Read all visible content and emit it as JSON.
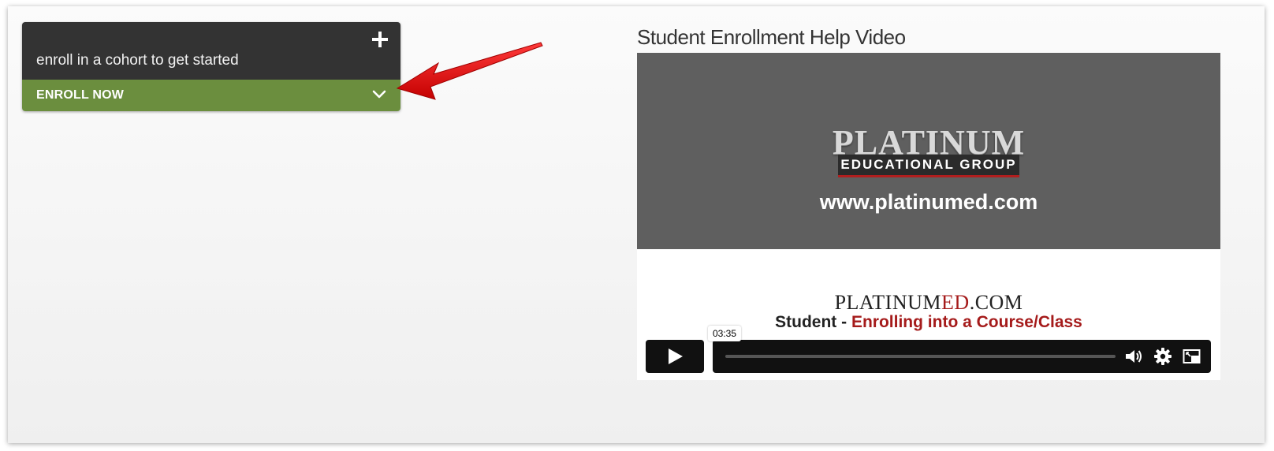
{
  "enroll_card": {
    "plus_icon": "plus-icon",
    "prompt_text": "enroll in a cohort to get started",
    "enroll_label": "ENROLL NOW",
    "chevron_icon": "chevron-down-icon",
    "colors": {
      "top": "#333333",
      "bottom": "#6b8e3e"
    }
  },
  "annotation": {
    "icon": "red-arrow",
    "color": "#e01414"
  },
  "video": {
    "title": "Student Enrollment Help Video",
    "thumbnail": {
      "logo_word": "PLATINUM",
      "logo_band": "EDUCATIONAL GROUP",
      "url": "www.platinumed.com",
      "brand_main": "PLATINUM",
      "brand_ed": "ED",
      "brand_tail": ".COM",
      "subtitle_prefix": "Student - ",
      "subtitle_highlight": "Enrolling into a Course/Class"
    },
    "player": {
      "play_icon": "play-icon",
      "duration": "03:35",
      "progress": 0.0,
      "volume_icon": "volume-icon",
      "settings_icon": "gear-icon",
      "pip_icon": "picture-in-picture-icon"
    }
  }
}
